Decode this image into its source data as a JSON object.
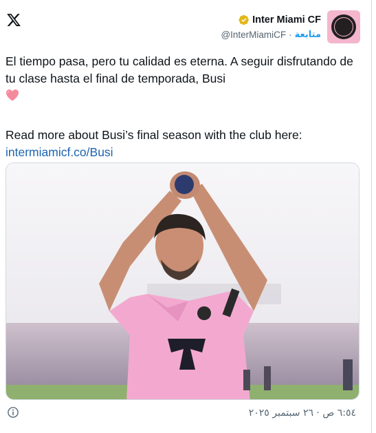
{
  "brand": {
    "icon": "x-logo-icon"
  },
  "author": {
    "display_name": "Inter Miami CF",
    "handle": "@InterMiamiCF",
    "follow_label": "متابعة",
    "verified_icon": "verified-gold-badge-icon",
    "avatar": "inter-miami-crest-avatar"
  },
  "tweet": {
    "text_line_1": "El tiempo pasa, pero tu calidad es eterna. A seguir disfrutando de tu clase hasta el final de temporada, Busi",
    "emoji": "❤️",
    "text_line_2": "Read more about Busi’s final season with the club here:",
    "link_text": "intermiamicf.co/Busi",
    "media": "player-applauding-photo",
    "timestamp": "٦:٥٤ ص · ٢٦ سبتمبر ٢٠٢٥"
  },
  "footer": {
    "info_icon": "info-icon"
  },
  "colors": {
    "accent": "#1d9bf0",
    "link": "#1d64b0",
    "brand_pink": "#f3b6cd",
    "verified_gold": "#e2b719"
  }
}
